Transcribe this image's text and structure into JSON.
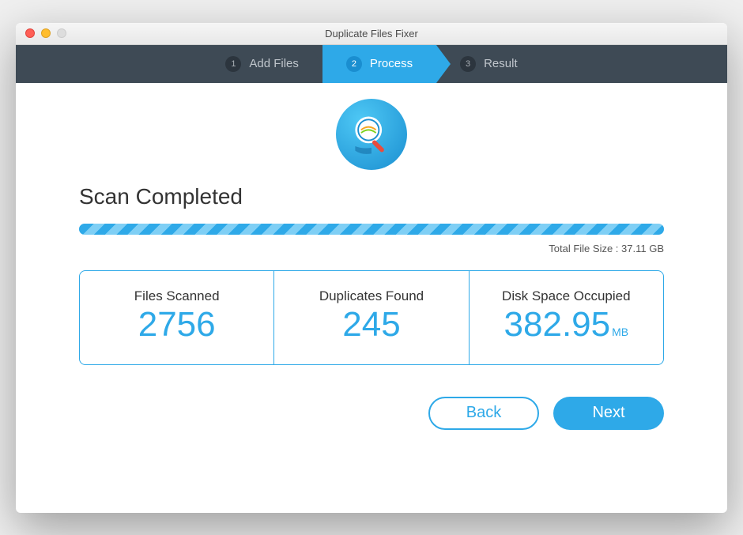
{
  "window": {
    "title": "Duplicate Files Fixer"
  },
  "stepper": {
    "steps": [
      {
        "num": "1",
        "label": "Add Files"
      },
      {
        "num": "2",
        "label": "Process"
      },
      {
        "num": "3",
        "label": "Result"
      }
    ],
    "active_index": 1
  },
  "heading": "Scan Completed",
  "total_filesize": {
    "prefix": "Total File Size : ",
    "value": "37.11 GB"
  },
  "stats": {
    "files_scanned": {
      "label": "Files Scanned",
      "value": "2756"
    },
    "duplicates_found": {
      "label": "Duplicates Found",
      "value": "245"
    },
    "disk_space": {
      "label": "Disk Space Occupied",
      "value": "382.95",
      "unit": "MB"
    }
  },
  "buttons": {
    "back": "Back",
    "next": "Next"
  }
}
